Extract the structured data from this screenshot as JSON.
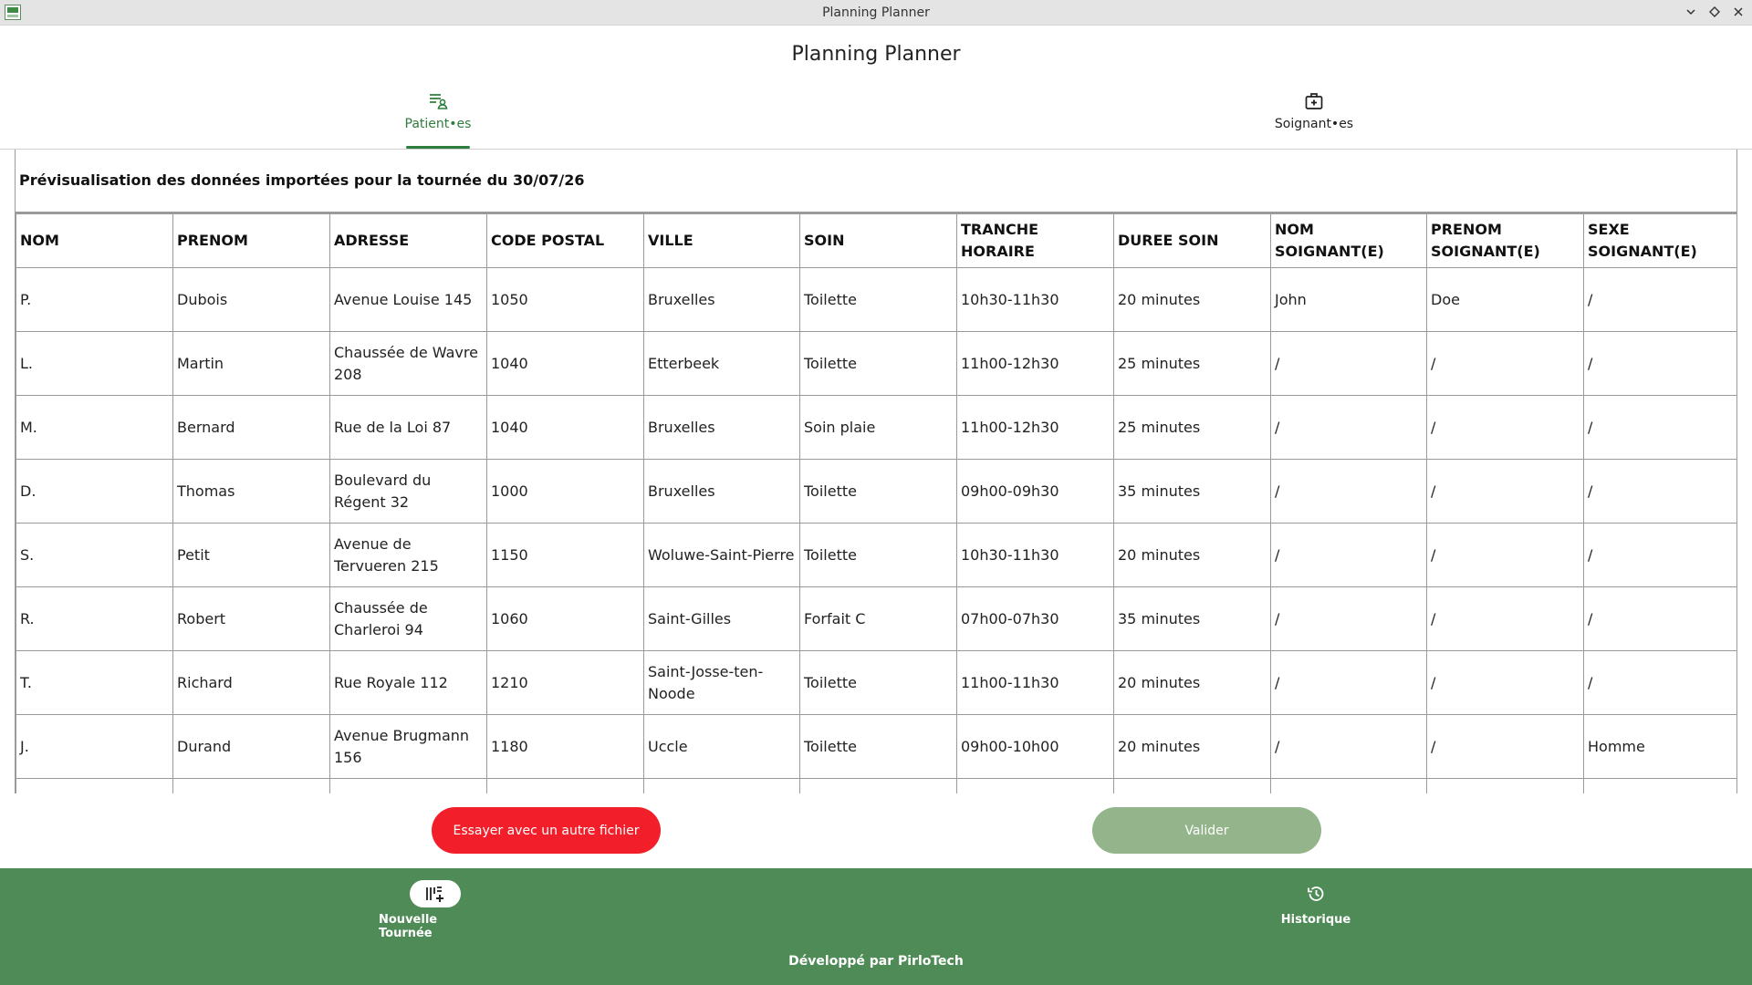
{
  "window": {
    "title": "Planning Planner",
    "controls": [
      "chevron-down-icon",
      "diamond-icon",
      "close-icon"
    ]
  },
  "app": {
    "title": "Planning Planner"
  },
  "tabs": [
    {
      "label": "Patient•es",
      "icon": "patient-list-icon",
      "active": true
    },
    {
      "label": "Soignant•es",
      "icon": "medical-kit-icon",
      "active": false
    }
  ],
  "preview": {
    "title": "Prévisualisation des données importées pour la tournée du 30/07/26",
    "columns": [
      "NOM",
      "PRENOM",
      "ADRESSE",
      "CODE POSTAL",
      "VILLE",
      "SOIN",
      "TRANCHE HORAIRE",
      "DUREE SOIN",
      "NOM SOIGNANT(E)",
      "PRENOM SOIGNANT(E)",
      "SEXE SOIGNANT(E)"
    ],
    "rows": [
      [
        "P.",
        "Dubois",
        "Avenue Louise 145",
        "1050",
        "Bruxelles",
        "Toilette",
        "10h30-11h30",
        "20 minutes",
        "John",
        "Doe",
        "/"
      ],
      [
        "L.",
        "Martin",
        "Chaussée de Wavre 208",
        "1040",
        "Etterbeek",
        "Toilette",
        "11h00-12h30",
        "25 minutes",
        "/",
        "/",
        "/"
      ],
      [
        "M.",
        "Bernard",
        "Rue de la Loi 87",
        "1040",
        "Bruxelles",
        "Soin plaie",
        "11h00-12h30",
        "25 minutes",
        "/",
        "/",
        "/"
      ],
      [
        "D.",
        "Thomas",
        "Boulevard du Régent 32",
        "1000",
        "Bruxelles",
        "Toilette",
        "09h00-09h30",
        "35 minutes",
        "/",
        "/",
        "/"
      ],
      [
        "S.",
        "Petit",
        "Avenue de Tervueren 215",
        "1150",
        "Woluwe-Saint-Pierre",
        "Toilette",
        "10h30-11h30",
        "20 minutes",
        "/",
        "/",
        "/"
      ],
      [
        "R.",
        "Robert",
        "Chaussée de Charleroi 94",
        "1060",
        "Saint-Gilles",
        "Forfait C",
        "07h00-07h30",
        "35 minutes",
        "/",
        "/",
        "/"
      ],
      [
        "T.",
        "Richard",
        "Rue Royale 112",
        "1210",
        "Saint-Josse-ten-Noode",
        "Toilette",
        "11h00-11h30",
        "20 minutes",
        "/",
        "/",
        "/"
      ],
      [
        "J.",
        "Durand",
        "Avenue Brugmann 156",
        "1180",
        "Uccle",
        "Toilette",
        "09h00-10h00",
        "20 minutes",
        "/",
        "/",
        "Homme"
      ]
    ]
  },
  "actions": {
    "retry_label": "Essayer avec un autre fichier",
    "validate_label": "Valider",
    "retry_color": "#f21f2a",
    "validate_color": "#94b58b"
  },
  "bottom_nav": {
    "items": [
      {
        "label": "Nouvelle Tournée",
        "icon": "add-list-icon",
        "active": true
      },
      {
        "label": "Historique",
        "icon": "history-icon",
        "active": false
      }
    ],
    "footer": "Développé par PirloTech",
    "background": "#4f8b56"
  },
  "colors": {
    "accent": "#2f7d3d"
  }
}
